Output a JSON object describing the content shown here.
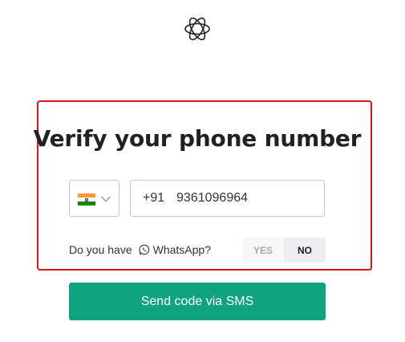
{
  "title": "Verify your phone number",
  "logo_icon": "openai-logo-icon",
  "country": {
    "flag_icon": "india-flag-icon",
    "chevron_icon": "chevron-down-icon"
  },
  "phone": {
    "value": "+91  9361096964"
  },
  "whatsapp": {
    "question": "Do you have",
    "label": "WhatsApp?",
    "icon": "whatsapp-icon",
    "yes_label": "YES",
    "no_label": "NO",
    "selected": "NO"
  },
  "send_button_label": "Send code via SMS",
  "colors": {
    "accent": "#10a37f",
    "highlight_border": "#e5101a",
    "text": "#202123"
  }
}
